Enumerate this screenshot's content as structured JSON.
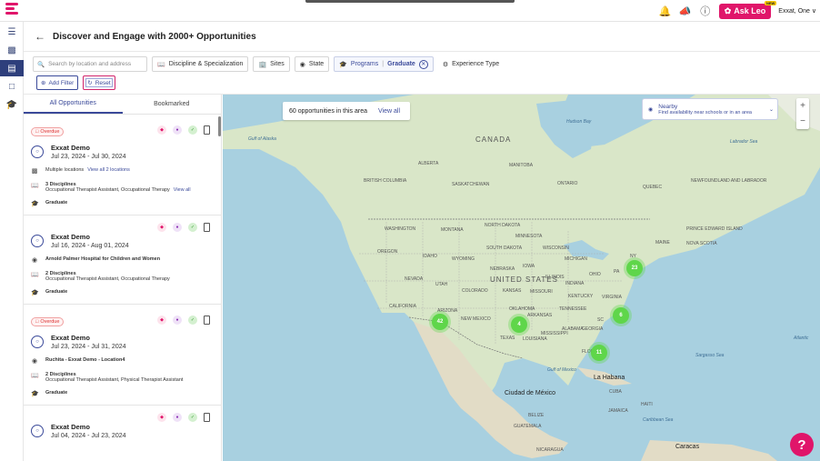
{
  "topbar": {
    "ask_leo": "Ask Leo",
    "new_badge": "NEW",
    "user": "Exxat, One ∨"
  },
  "header": {
    "title": "Discover and Engage with 2000+ Opportunities"
  },
  "filters": {
    "search_placeholder": "Search by location and address",
    "discipline": "Discipline & Specialization",
    "sites": "Sites",
    "state": "State",
    "programs": "Programs",
    "programs_value": "Graduate",
    "experience": "Experience Type",
    "add_filter": "Add Filter",
    "reset": "Reset"
  },
  "tabs": {
    "all": "All Opportunities",
    "bookmarked": "Bookmarked"
  },
  "cards": [
    {
      "overdue": "Overdue",
      "org": "Exxat Demo",
      "date": "Jul 23, 2024 - Jul 30, 2024",
      "location": "Multiple locations",
      "location_link": "View all 2 locations",
      "disciplines": "3 Disciplines",
      "discipline_list": "Occupational Therapist Assistant, Occupational Therapy",
      "discipline_link": "View all",
      "program": "Graduate"
    },
    {
      "overdue": "",
      "org": "Exxat Demo",
      "date": "Jul 16, 2024 - Aug 01, 2024",
      "location": "Arnold Palmer Hospital for Children and Women",
      "location_link": "",
      "disciplines": "2 Disciplines",
      "discipline_list": "Occupational Therapist Assistant, Occupational Therapy",
      "discipline_link": "",
      "program": "Graduate"
    },
    {
      "overdue": "Overdue",
      "org": "Exxat Demo",
      "date": "Jul 23, 2024 - Jul 31, 2024",
      "location": "Ruchita - Exxat Demo - Location4",
      "location_link": "",
      "disciplines": "2 Disciplines",
      "discipline_list": "Occupational Therapist Assistant, Physical Therapist Assistant",
      "discipline_link": "",
      "program": "Graduate"
    },
    {
      "overdue": "",
      "org": "Exxat Demo",
      "date": "Jul 04, 2024 - Jul 23, 2024"
    }
  ],
  "map": {
    "count_text": "60 opportunities in this area",
    "view_all": "View all",
    "nearby_title": "Nearby",
    "nearby_sub": "Find availability near schools or in an area",
    "clusters": [
      "42",
      "4",
      "23",
      "6",
      "11"
    ],
    "labels": {
      "canada": "CANADA",
      "us": "UNITED STATES",
      "mexico": "Ciudad de México",
      "havana": "La Habana",
      "caracas": "Caracas",
      "hudson": "Hudson Bay",
      "alaska_gulf": "Gulf of Alaska",
      "labrador": "Labrador Sea",
      "gulf_mexico": "Gulf of Mexico",
      "sargasso": "Sargasso Sea",
      "atlantic": "Atlantic",
      "caribbean": "Caribbean Sea",
      "bc": "BRITISH COLUMBIA",
      "alberta": "ALBERTA",
      "sask": "SASKATCHEWAN",
      "manitoba": "MANITOBA",
      "ontario": "ONTARIO",
      "quebec": "QUEBEC",
      "nl": "NEWFOUNDLAND AND LABRADOR",
      "pei": "PRINCE EDWARD ISLAND",
      "ns": "NOVA SCOTIA",
      "washington": "WASHINGTON",
      "oregon": "OREGON",
      "montana": "MONTANA",
      "idaho": "IDAHO",
      "wyoming": "WYOMING",
      "nevada": "NEVADA",
      "utah": "UTAH",
      "california": "CALIFORNIA",
      "colorado": "COLORADO",
      "arizona": "ARIZONA",
      "new_mexico": "NEW MEXICO",
      "north_dakota": "NORTH DAKOTA",
      "south_dakota": "SOUTH DAKOTA",
      "nebraska": "NEBRASKA",
      "kansas": "KANSAS",
      "oklahoma": "OKLAHOMA",
      "texas": "TEXAS",
      "minnesota": "MINNESOTA",
      "iowa": "IOWA",
      "missouri": "MISSOURI",
      "arkansas": "ARKANSAS",
      "wisconsin": "WISCONSIN",
      "illinois": "ILLINOIS",
      "michigan": "MICHIGAN",
      "indiana": "INDIANA",
      "ohio": "OHIO",
      "kentucky": "KENTUCKY",
      "tennessee": "TENNESSEE",
      "mississippi": "MISSISSIPPI",
      "alabama": "ALABAMA",
      "georgia": "GEORGIA",
      "louisiana": "LOUISIANA",
      "florida": "FLORIDA",
      "virginia": "VIRGINIA",
      "pa": "PA",
      "ny": "NY",
      "maine": "MAINE",
      "sc": "SC",
      "cuba": "CUBA",
      "jamaica": "JAMAICA",
      "haiti": "HAITI",
      "guatemala": "GUATEMALA",
      "nicaragua": "NICARAGUA",
      "belize": "BELIZE"
    }
  },
  "colors": {
    "brand": "#e0156a",
    "primary": "#3b4a9a",
    "cluster": "#5fd64a"
  }
}
